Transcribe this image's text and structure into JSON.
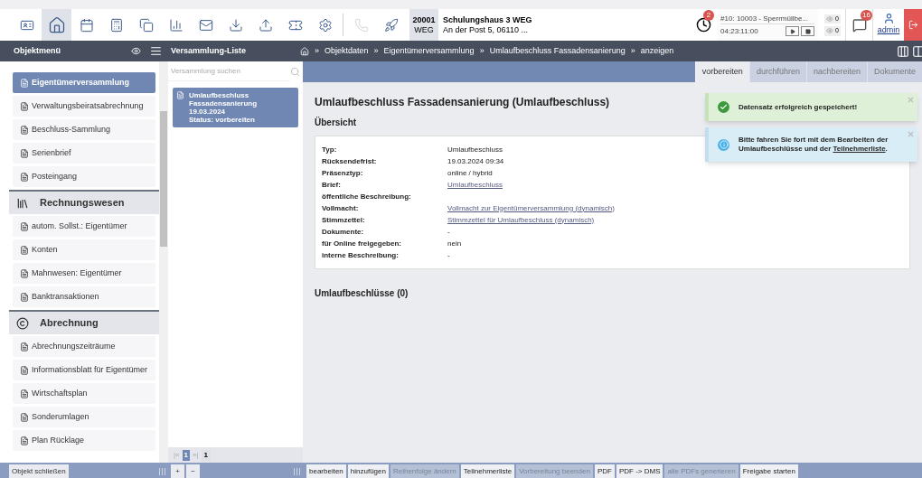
{
  "toolbar": [
    {
      "selected": false,
      "disabled": false
    },
    {
      "selected": true,
      "disabled": false
    },
    {
      "selected": false,
      "disabled": false
    },
    {
      "selected": false,
      "disabled": false
    },
    {
      "selected": false,
      "disabled": false
    },
    {
      "selected": false,
      "disabled": false
    },
    {
      "selected": false,
      "disabled": false
    },
    {
      "selected": false,
      "disabled": false
    },
    {
      "selected": false,
      "disabled": false
    },
    {
      "selected": false,
      "disabled": false
    },
    {
      "selected": false,
      "disabled": false
    },
    {
      "selected": false,
      "disabled": true
    },
    {
      "selected": false,
      "disabled": false
    }
  ],
  "object": {
    "number": "20001",
    "type": "WEG",
    "name": "Schulungshaus 3 WEG",
    "address": "An der Post 5, 06110 ..."
  },
  "timer": {
    "badge": "2",
    "task": "#10: 10003 - Sperrmüllbe...",
    "time": "04:23:11:00"
  },
  "counters": [
    "0",
    "0"
  ],
  "messages_badge": "16",
  "user": "admin",
  "sidebar": {
    "title": "Objektmenü",
    "items": [
      {
        "kind": "item",
        "label": "Eigentümerversammlung",
        "selected": true
      },
      {
        "kind": "item",
        "label": "Verwaltungsbeiratsabrechnung",
        "selected": false
      },
      {
        "kind": "item",
        "label": "Beschluss-Sammlung",
        "selected": false
      },
      {
        "kind": "item",
        "label": "Serienbrief",
        "selected": false
      },
      {
        "kind": "item",
        "label": "Posteingang",
        "selected": false
      },
      {
        "kind": "section",
        "label": "Rechnungswesen"
      },
      {
        "kind": "item",
        "label": "autom. Sollst.: Eigentümer",
        "selected": false
      },
      {
        "kind": "item",
        "label": "Konten",
        "selected": false
      },
      {
        "kind": "item",
        "label": "Mahnwesen: Eigentümer",
        "selected": false
      },
      {
        "kind": "item",
        "label": "Banktransaktionen",
        "selected": false
      },
      {
        "kind": "section",
        "label": "Abrechnung"
      },
      {
        "kind": "item",
        "label": "Abrechnungszeiträume",
        "selected": false
      },
      {
        "kind": "item",
        "label": "Informationsblatt für Eigentümer",
        "selected": false
      },
      {
        "kind": "item",
        "label": "Wirtschaftsplan",
        "selected": false
      },
      {
        "kind": "item",
        "label": "Sonderumlagen",
        "selected": false
      },
      {
        "kind": "item",
        "label": "Plan Rücklage",
        "selected": false
      }
    ]
  },
  "list": {
    "title": "Versammlung-Liste",
    "search": {
      "placeholder": "Versammlung suchen"
    },
    "items": [
      {
        "title": "Umlaufbeschluss Fassadensanierung",
        "date": "19.03.2024",
        "status": "Status: vorbereiten",
        "selected": true
      }
    ],
    "pager": {
      "first": "|«",
      "page": "1",
      "last": "»|",
      "total": "1"
    }
  },
  "breadcrumb": {
    "separator": "»",
    "items": [
      "Objektdaten",
      "Eigentümerversammlung",
      "Umlaufbeschluss Fassadensanierung",
      "anzeigen"
    ]
  },
  "tabs": [
    {
      "label": "vorbereiten",
      "selected": true
    },
    {
      "label": "durchführen",
      "selected": false
    },
    {
      "label": "nachbereiten",
      "selected": false
    },
    {
      "label": "Dokumente",
      "selected": false
    }
  ],
  "detail": {
    "title": "Umlaufbeschluss Fassadensanierung (Umlaufbeschluss)",
    "section": "Übersicht",
    "fields": [
      {
        "label": "Typ:",
        "value": "Umlaufbeschluss",
        "kind": "text"
      },
      {
        "label": "Rücksendefrist:",
        "value": "19.03.2024 09:34",
        "kind": "text"
      },
      {
        "label": "Präsenztyp:",
        "value": "online / hybrid",
        "kind": "text"
      },
      {
        "label": "Brief:",
        "value": "Umlaufbeschluss",
        "kind": "link"
      },
      {
        "label": "öffentliche Beschreibung:"
      },
      {
        "label": "Vollmacht:",
        "value": "Vollmacht zur Eigentümerversammlung (dynamisch)",
        "kind": "link"
      },
      {
        "label": "Stimmzettel:",
        "value": "Stimmzettel für Umlaufbeschluss (dynamisch)",
        "kind": "link"
      },
      {
        "label": "Dokumente:",
        "value": "-",
        "kind": "text"
      },
      {
        "label": "für Online freigegeben:",
        "value": "nein",
        "kind": "text"
      },
      {
        "label": "interne Beschreibung:",
        "value": "-",
        "kind": "text"
      }
    ],
    "subsection": "Umlaufbeschlüsse (0)"
  },
  "notifications": [
    {
      "kind": "success",
      "text": "Datensatz erfolgreich gespeichert!"
    },
    {
      "kind": "info",
      "text": "Bitte fahren Sie fort mit dem Bearbeiten der Umlaufbeschlüsse und der",
      "link": "Teilnehmerliste",
      "suffix": "."
    }
  ],
  "footer": {
    "close": "Objekt schließen",
    "list_buttons": [
      "+",
      "−"
    ],
    "actions": [
      {
        "label": "bearbeiten",
        "disabled": false
      },
      {
        "label": "hinzufügen",
        "disabled": false
      },
      {
        "label": "Reihenfolge ändern",
        "disabled": true
      },
      {
        "label": "Teilnehmerliste",
        "disabled": false
      },
      {
        "label": "Vorbereitung beenden",
        "disabled": true
      },
      {
        "label": "PDF",
        "disabled": false
      },
      {
        "label": "PDF -> DMS",
        "disabled": false
      },
      {
        "label": "alle PDFs generieren",
        "disabled": true
      },
      {
        "label": "Freigabe starten",
        "disabled": false
      }
    ]
  }
}
